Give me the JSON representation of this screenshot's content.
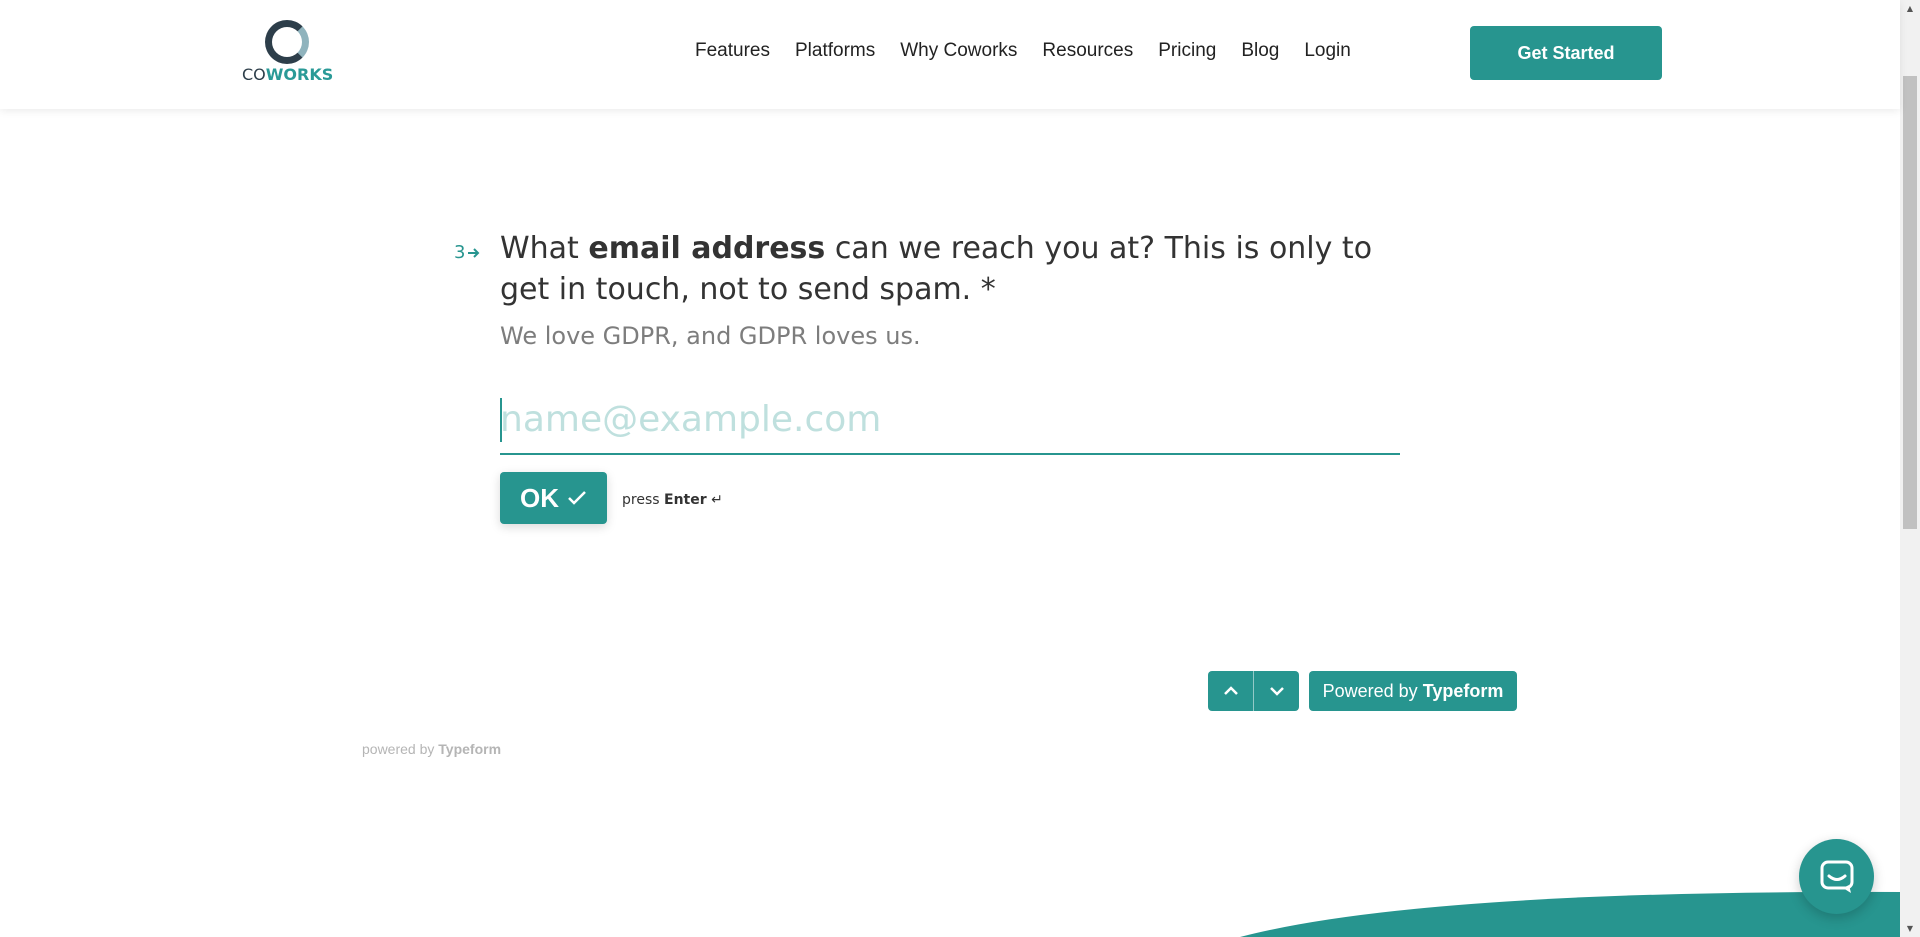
{
  "header": {
    "logo": {
      "co": "CO",
      "works": "WORKS"
    },
    "nav": [
      "Features",
      "Platforms",
      "Why Coworks",
      "Resources",
      "Pricing",
      "Blog",
      "Login"
    ],
    "cta_label": "Get Started"
  },
  "question": {
    "number": "3",
    "title_before": "What ",
    "title_bold": "email address",
    "title_after": " can we reach you at? This is only to get in touch, not to send spam. *",
    "subtitle": "We love GDPR, and GDPR loves us.",
    "input_placeholder": "name@example.com",
    "input_value": "",
    "ok_label": "OK",
    "hint_press": "press",
    "hint_key": "Enter",
    "hint_symbol": "↵"
  },
  "footer": {
    "powered_prefix": "Powered by",
    "powered_brand": "Typeform",
    "powered_small_prefix": "powered by",
    "powered_small_brand": "Typeform"
  },
  "colors": {
    "accent": "#27958f",
    "dark": "#2d3e4a",
    "placeholder": "#bfe0de"
  },
  "icons": {
    "arrow_next": "arrow-right-icon",
    "check": "check-icon",
    "enter": "enter-icon",
    "up": "chevron-up-icon",
    "down": "chevron-down-icon",
    "chat": "chat-icon"
  }
}
